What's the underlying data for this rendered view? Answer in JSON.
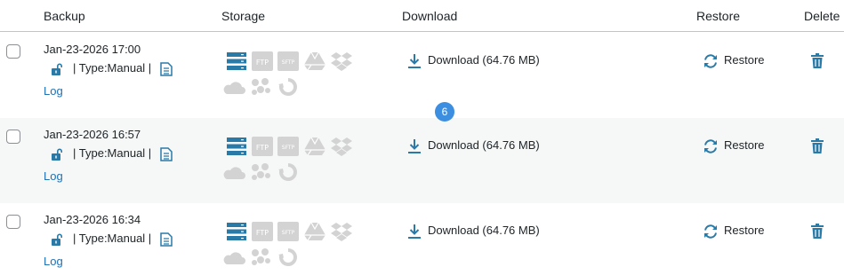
{
  "headers": {
    "backup": "Backup",
    "storage": "Storage",
    "download": "Download",
    "restore": "Restore",
    "delete": "Delete"
  },
  "rows": [
    {
      "date": "Jan-23-2026 17:00",
      "type": "| Type:Manual |",
      "log": "Log",
      "download": "Download (64.76 MB)",
      "restore": "Restore"
    },
    {
      "date": "Jan-23-2026 16:57",
      "type": "| Type:Manual |",
      "log": "Log",
      "download": "Download (64.76 MB)",
      "restore": "Restore"
    },
    {
      "date": "Jan-23-2026 16:34",
      "type": "| Type:Manual |",
      "log": "Log",
      "download": "Download (64.76 MB)",
      "restore": "Restore"
    }
  ],
  "storage_icons": {
    "ftp_label": "FTP",
    "sftp_label": "SFTP"
  },
  "badge": "6",
  "colors": {
    "accent": "#2271b1",
    "icon_blue": "#2a7aa8",
    "storage_gray": "#d3d3d3",
    "badge": "#3c8fe0"
  },
  "icons": [
    "unlock-icon",
    "document-icon",
    "local-storage-icon",
    "ftp-icon",
    "sftp-icon",
    "google-drive-icon",
    "dropbox-icon",
    "cloud-icon",
    "cluster-icon",
    "sync-icon",
    "download-icon",
    "restore-icon",
    "trash-icon"
  ]
}
